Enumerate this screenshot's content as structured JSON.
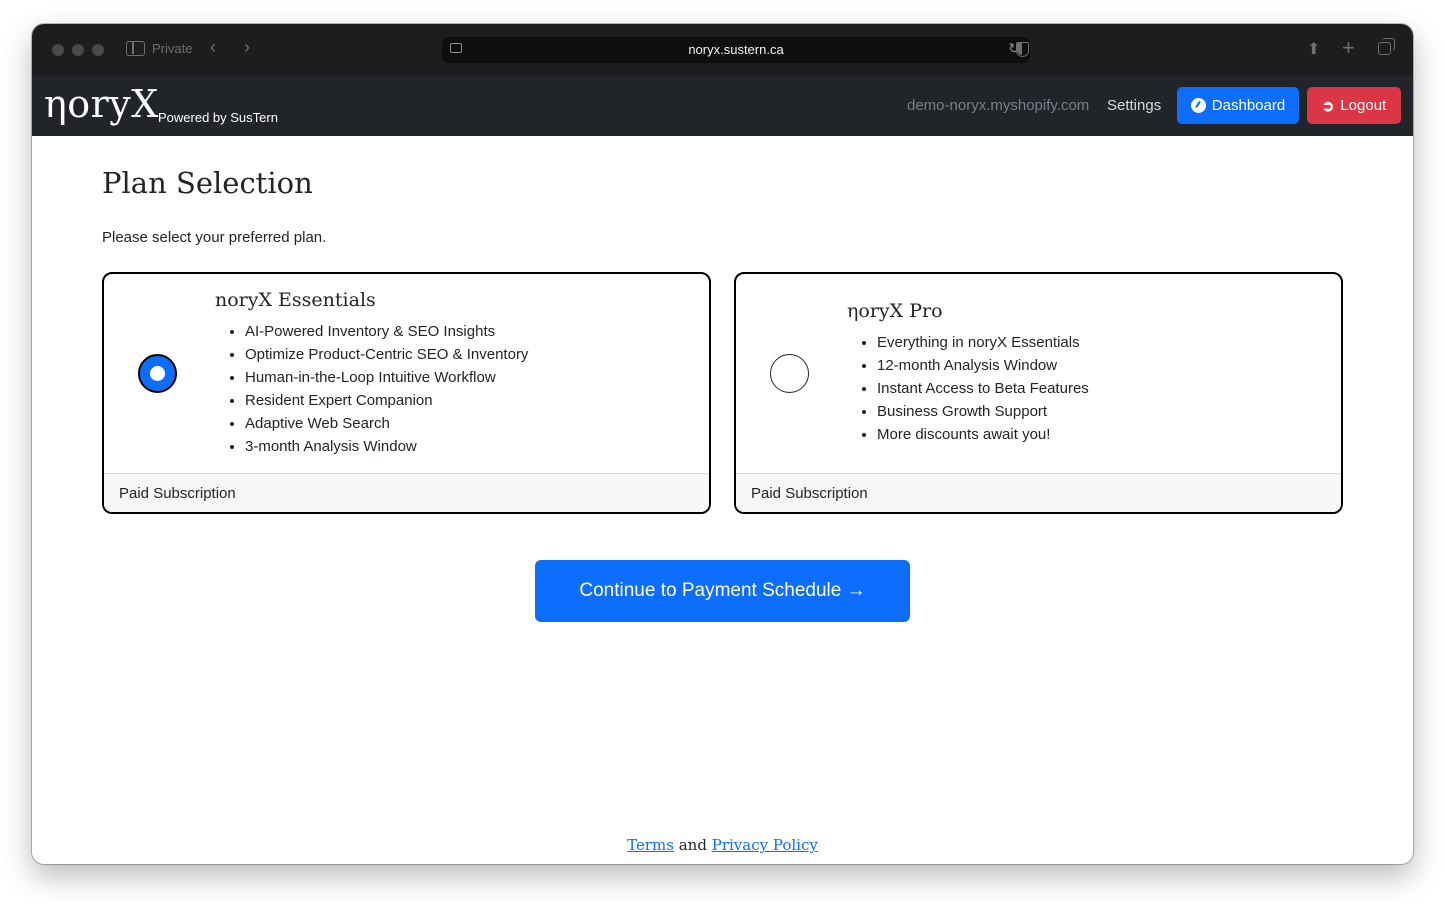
{
  "browser": {
    "private_label": "Private",
    "url": "noryx.sustern.ca"
  },
  "navbar": {
    "brand": "ηoryX",
    "brand_sub": "Powered by SusTern",
    "shop_domain": "demo-noryx.myshopify.com",
    "settings_label": "Settings",
    "dashboard_label": "Dashboard",
    "logout_label": "Logout"
  },
  "page": {
    "title": "Plan Selection",
    "subtitle": "Please select your preferred plan."
  },
  "plans": [
    {
      "name": "noryX Essentials",
      "selected": true,
      "features": [
        "AI-Powered Inventory & SEO Insights",
        "Optimize Product-Centric SEO & Inventory",
        "Human-in-the-Loop Intuitive Workflow",
        "Resident Expert Companion",
        "Adaptive Web Search",
        "3-month Analysis Window"
      ],
      "footer": "Paid Subscription"
    },
    {
      "name": "ηoryX Pro",
      "selected": false,
      "features": [
        "Everything in noryX Essentials",
        "12-month Analysis Window",
        "Instant Access to Beta Features",
        "Business Growth Support",
        "More discounts await you!"
      ],
      "footer": "Paid Subscription"
    }
  ],
  "continue_label": "Continue to Payment Schedule →",
  "footer": {
    "terms": "Terms",
    "and": "and",
    "privacy": "Privacy Policy"
  },
  "colors": {
    "primary": "#0d6efd",
    "danger": "#dc3545",
    "navbar": "#212529"
  }
}
